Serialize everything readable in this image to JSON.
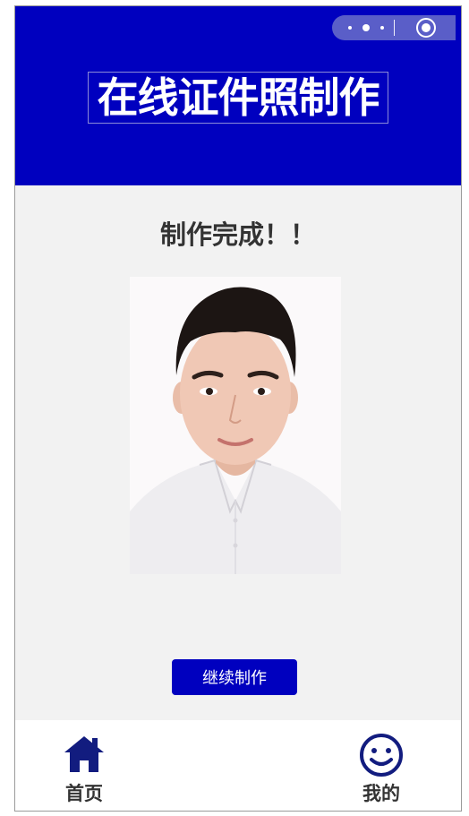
{
  "header": {
    "title": "在线证件照制作",
    "background": "#0000bf",
    "capsule_icons": [
      "more-dots-icon",
      "close-circle-icon"
    ]
  },
  "main": {
    "status": "制作完成！！",
    "photo_alt": "证件照",
    "continue_button": "继续制作"
  },
  "tabbar": {
    "items": [
      {
        "label": "首页",
        "icon": "home-icon"
      },
      {
        "label": "我的",
        "icon": "smiley-face-icon"
      }
    ],
    "icon_color": "#121c7f"
  }
}
